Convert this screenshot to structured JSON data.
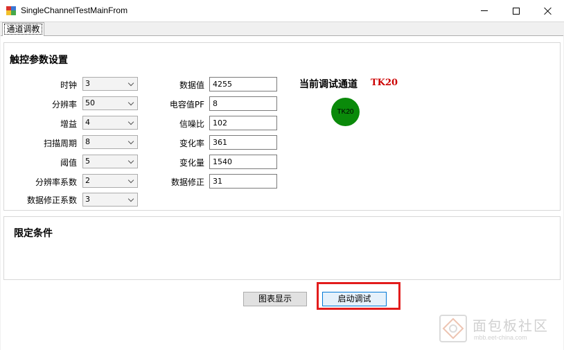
{
  "window": {
    "title": "SingleChannelTestMainFrom",
    "minimize_icon": "minimize-icon",
    "maximize_icon": "maximize-icon",
    "close_icon": "close-icon"
  },
  "tabs": [
    {
      "label": "通道调教",
      "selected": true
    }
  ],
  "touch_group": {
    "title": "触控参数设置",
    "combos": [
      {
        "label": "时钟",
        "value": "3"
      },
      {
        "label": "分辨率",
        "value": "50"
      },
      {
        "label": "增益",
        "value": "4"
      },
      {
        "label": "扫描周期",
        "value": "8"
      },
      {
        "label": "阈值",
        "value": "5"
      },
      {
        "label": "分辨率系数",
        "value": "2"
      },
      {
        "label": "数据修正系数",
        "value": "3"
      }
    ],
    "fields": [
      {
        "label": "数据值",
        "value": "4255"
      },
      {
        "label": "电容值PF",
        "value": "8"
      },
      {
        "label": "信噪比",
        "value": "102"
      },
      {
        "label": "变化率",
        "value": "361"
      },
      {
        "label": "变化量",
        "value": "1540"
      },
      {
        "label": "数据修正",
        "value": "31"
      }
    ],
    "current_channel_label": "当前调试通道",
    "current_channel_value": "TK20",
    "channel_indicator": {
      "label": "TK20",
      "color": "#0a8a0a"
    }
  },
  "limit_group": {
    "title": "限定条件"
  },
  "buttons": {
    "chart_label": "图表显示",
    "start_label": "启动调试"
  },
  "watermark": {
    "text": "面包板社区",
    "sub": "mbb.eet-china.com"
  },
  "colors": {
    "highlight_border": "#e21c1c",
    "current_channel": "#cc0000",
    "indicator": "#0a8a0a"
  }
}
